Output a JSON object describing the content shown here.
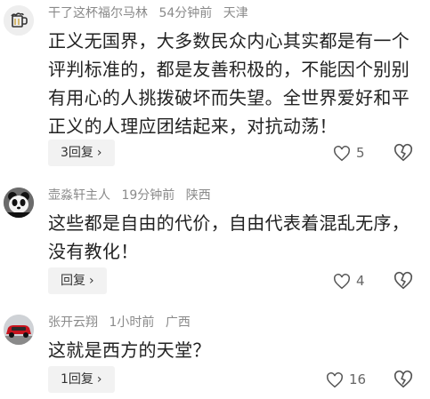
{
  "comments": [
    {
      "username": "干了这杯福尔马林",
      "time": "54分钟前",
      "location": "天津",
      "text": "正义无国界，大多数民众内心其实都是有一个评判标准的，都是友善积极的，不能因个别别有用心的人挑拨破坏而失望。全世界爱好和平正义的人理应团结起来，对抗动荡！",
      "reply_label": "3回复",
      "likes": "5",
      "avatar_icon": "beer-mug-icon"
    },
    {
      "username": "壶淼轩主人",
      "time": "19分钟前",
      "location": "陕西",
      "text": "这些都是自由的代价，自由代表着混乱无序，没有教化！",
      "reply_label": "回复",
      "likes": "4",
      "avatar_icon": "panda-icon"
    },
    {
      "username": "张开云翔",
      "time": "1小时前",
      "location": "广西",
      "text": "这就是西方的天堂？",
      "reply_label": "1回复",
      "likes": "16",
      "avatar_icon": "red-car-icon"
    }
  ],
  "colors": {
    "meta": "#8a8a8a",
    "text": "#222222",
    "button_bg": "#f2f2f2"
  }
}
